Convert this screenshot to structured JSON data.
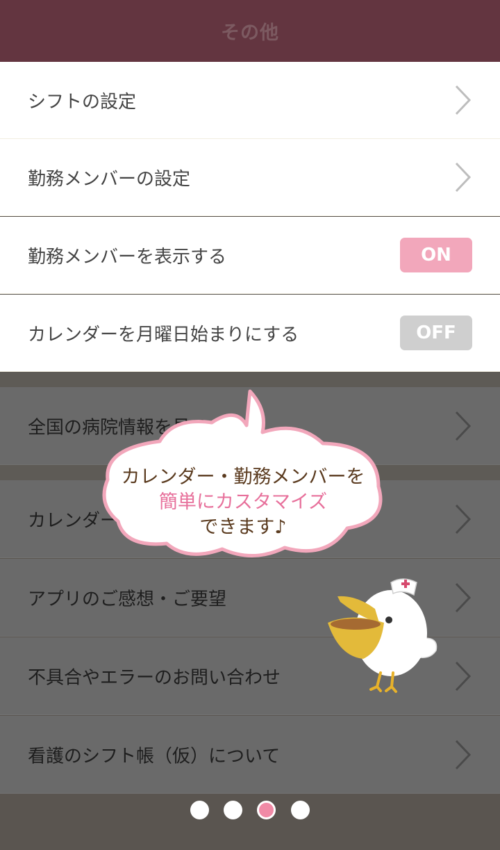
{
  "header": {
    "title": "その他"
  },
  "settings": [
    {
      "label": "シフトの設定"
    },
    {
      "label": "勤務メンバーの設定"
    },
    {
      "label": "勤務メンバーを表示する",
      "toggle": "ON"
    },
    {
      "label": "カレンダーを月曜日始まりにする",
      "toggle": "OFF"
    }
  ],
  "links": [
    {
      "label": "全国の病院情報を見る"
    },
    {
      "label": "カレンダー"
    },
    {
      "label": "アプリのご感想・ご要望"
    },
    {
      "label": "不具合やエラーのお問い合わせ"
    },
    {
      "label": "看護のシフト帳（仮）について"
    }
  ],
  "tooltip": {
    "line1": "カレンダー・勤務メンバーを",
    "line2": "簡単にカスタマイズ",
    "line3": "できます♪"
  },
  "pager": {
    "total": 4,
    "active_index": 3
  },
  "colors": {
    "header_bg": "#633540",
    "toggle_on": "#f2a7bb",
    "toggle_off": "#cfcfcf",
    "accent_pink": "#f08aa6"
  }
}
